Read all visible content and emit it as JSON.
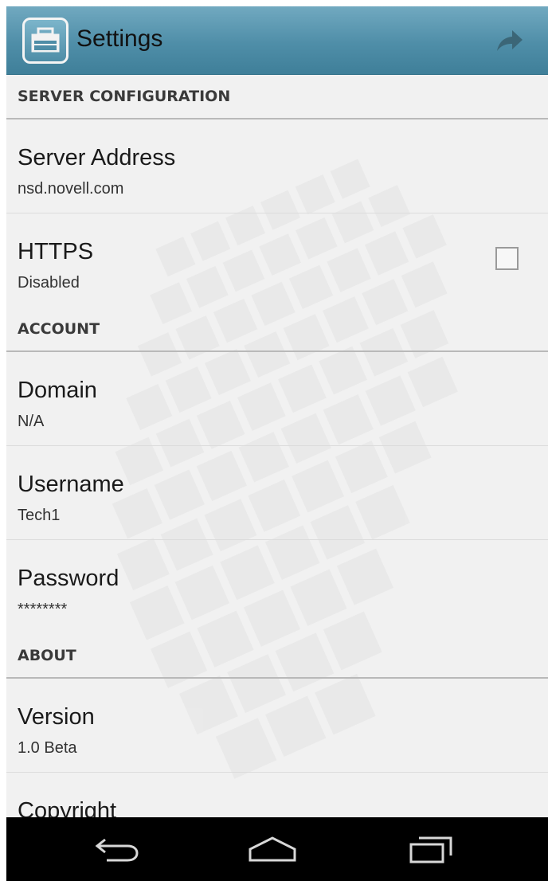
{
  "app": {
    "title": "Settings",
    "icon": "app-toolbox-icon",
    "forward_icon": "forward-arrow-icon",
    "accent_color": "#4f8ea8"
  },
  "sections": [
    {
      "header": "SERVER CONFIGURATION",
      "items": [
        {
          "label": "Server Address",
          "value": "nsd.novell.com"
        },
        {
          "label": "HTTPS",
          "value": "Disabled",
          "checked": false
        }
      ]
    },
    {
      "header": "ACCOUNT",
      "items": [
        {
          "label": "Domain",
          "value": "N/A"
        },
        {
          "label": "Username",
          "value": "Tech1"
        },
        {
          "label": "Password",
          "value": "********"
        }
      ]
    },
    {
      "header": "ABOUT",
      "items": [
        {
          "label": "Version",
          "value": "1.0 Beta"
        },
        {
          "label": "Copyright"
        }
      ]
    }
  ],
  "nav": {
    "back_icon": "back-icon",
    "home_icon": "home-icon",
    "recent_icon": "recent-apps-icon"
  }
}
